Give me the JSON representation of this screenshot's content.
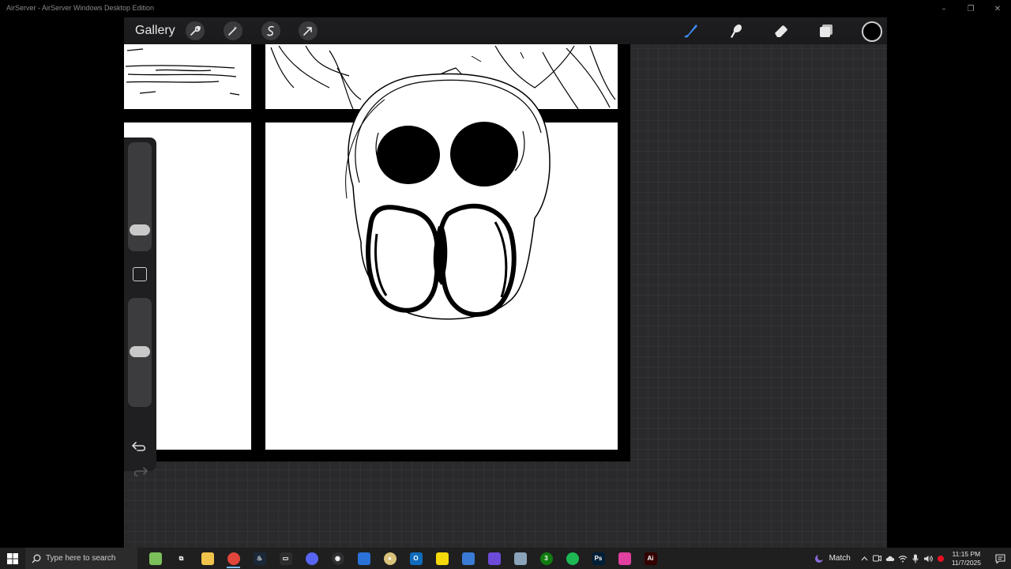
{
  "host": {
    "title": "AirServer - AirServer Windows Desktop Edition",
    "controls": {
      "minimize": "–",
      "restore": "❐",
      "close": "✕"
    }
  },
  "procreate": {
    "gallery_label": "Gallery",
    "left_tools": [
      "wrench-icon",
      "magic-wand-icon",
      "selection-icon",
      "transform-icon"
    ],
    "right_tools": [
      "brush-icon",
      "smudge-icon",
      "eraser-icon",
      "layers-icon"
    ],
    "brush_color": "#000000",
    "accent_color": "#3f8cf2",
    "sidebar": {
      "brush_size_level": 0.2,
      "opacity_level": 0.5
    }
  },
  "taskbar": {
    "search_placeholder": "Type here to search",
    "apps": [
      {
        "name": "potion-app",
        "color": "#7bbf5a",
        "glyph": ""
      },
      {
        "name": "task-view",
        "color": "#1f1f1f",
        "glyph": "⧉"
      },
      {
        "name": "file-explorer",
        "color": "#f0c44c",
        "glyph": ""
      },
      {
        "name": "chrome",
        "color": "#e0463a",
        "glyph": ""
      },
      {
        "name": "steam",
        "color": "#1b2838",
        "glyph": "♨"
      },
      {
        "name": "store",
        "color": "#2d2d2d",
        "glyph": "▭"
      },
      {
        "name": "discord",
        "color": "#5865f2",
        "glyph": ""
      },
      {
        "name": "obs",
        "color": "#302e31",
        "glyph": "◉"
      },
      {
        "name": "app-blue",
        "color": "#2a72d8",
        "glyph": ""
      },
      {
        "name": "app-disc",
        "color": "#d9c27a",
        "glyph": "●"
      },
      {
        "name": "outlook",
        "color": "#0f6cbd",
        "glyph": "O"
      },
      {
        "name": "sticky-notes",
        "color": "#f5d90a",
        "glyph": ""
      },
      {
        "name": "app-cube",
        "color": "#3a7bd5",
        "glyph": ""
      },
      {
        "name": "app-purple",
        "color": "#6b4bd8",
        "glyph": ""
      },
      {
        "name": "app-cloud",
        "color": "#8aa3b8",
        "glyph": ""
      },
      {
        "name": "xbox",
        "color": "#107c10",
        "glyph": "3"
      },
      {
        "name": "spotify",
        "color": "#1db954",
        "glyph": ""
      },
      {
        "name": "photoshop",
        "color": "#001e36",
        "glyph": "Ps"
      },
      {
        "name": "app-gradient",
        "color": "#e040a0",
        "glyph": ""
      },
      {
        "name": "illustrator",
        "color": "#330000",
        "glyph": "Ai"
      }
    ],
    "weather_label": "Match",
    "time": "11:15 PM",
    "date": "11/7/2025"
  }
}
